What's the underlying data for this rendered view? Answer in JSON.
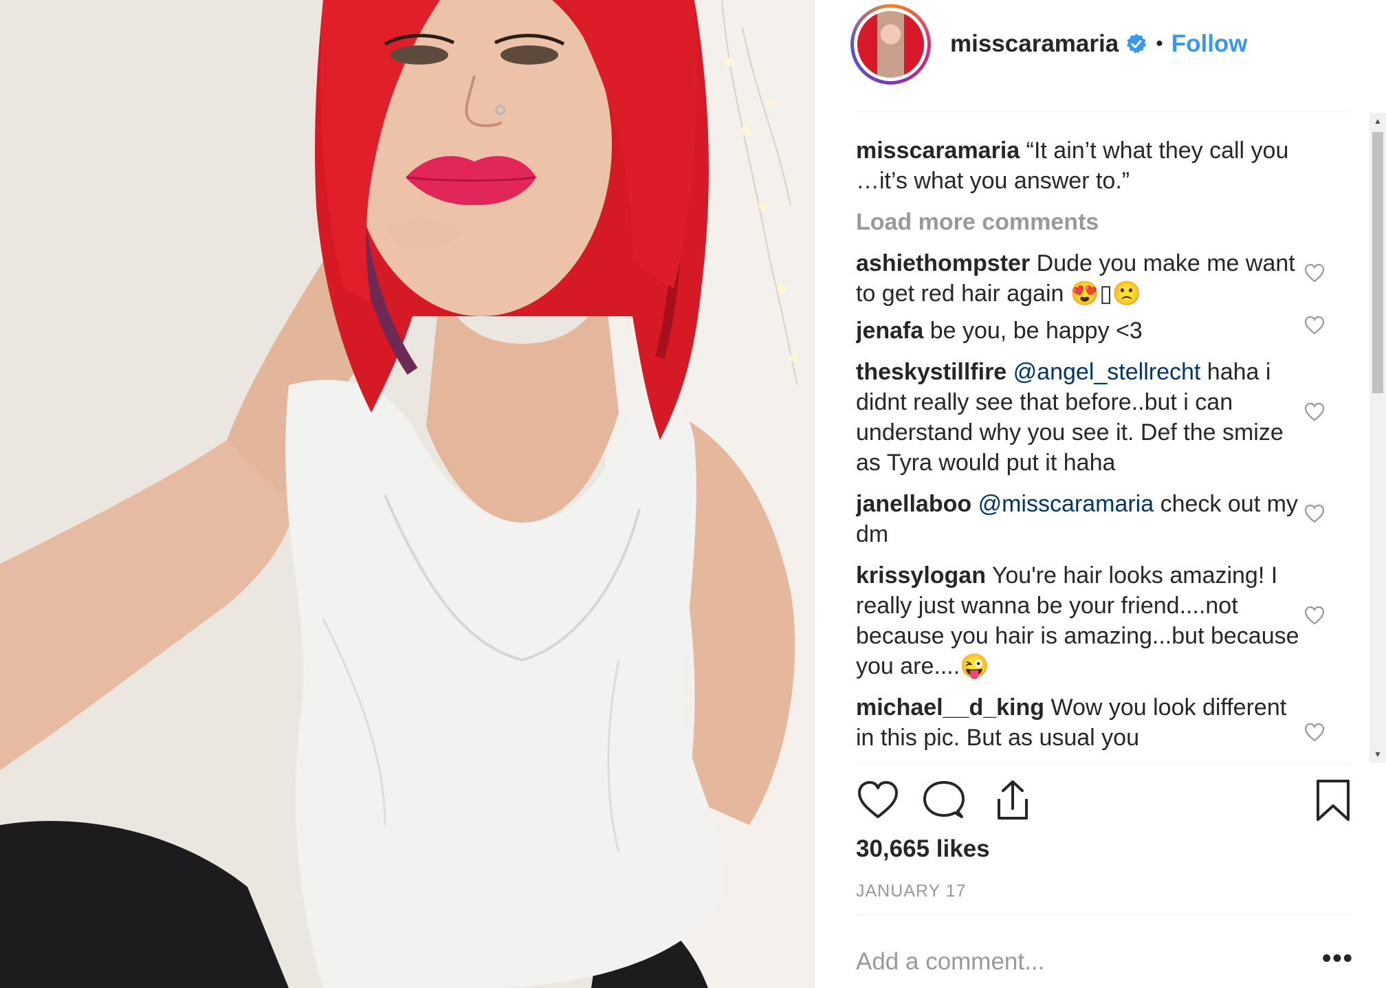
{
  "post": {
    "username": "misscaramaria",
    "follow_label": "Follow",
    "separator": "•",
    "caption": {
      "username": "misscaramaria",
      "text": "“It ain’t what they call you …it’s what you answer to.”"
    },
    "load_more_label": "Load more comments",
    "likes_text": "30,665 likes",
    "date_text": "JANUARY 17",
    "add_comment_placeholder": "Add a comment...",
    "more_options_label": "•••"
  },
  "comments": [
    {
      "username": "ashiethompster",
      "text": "Dude you make me want to get red hair again 😍▯🙁"
    },
    {
      "username": "jenafa",
      "text": "be you, be happy <3"
    },
    {
      "username": "theskystillfire",
      "mention": "@angel_stellrecht",
      "text": "haha i didnt really see that before..but i can understand why you see it. Def the smize as Tyra would put it haha"
    },
    {
      "username": "janellaboo",
      "mention": "@misscaramaria",
      "text": "check out my dm"
    },
    {
      "username": "krissylogan",
      "text": "You're hair looks amazing! I really just wanna be your friend....not because you hair is amazing...but because you are....😜"
    },
    {
      "username": "michael__d_king",
      "text": "Wow you look different in this pic. But as usual you"
    }
  ],
  "icons": {
    "verified": "verified-badge-icon",
    "like": "heart-outline-icon",
    "comment": "speech-bubble-icon",
    "share": "share-upload-icon",
    "save": "bookmark-icon",
    "comment_like": "small-heart-icon"
  },
  "colors": {
    "link_blue": "#3897f0",
    "mention_blue": "#003569",
    "muted_gray": "#999999",
    "text": "#262626"
  }
}
